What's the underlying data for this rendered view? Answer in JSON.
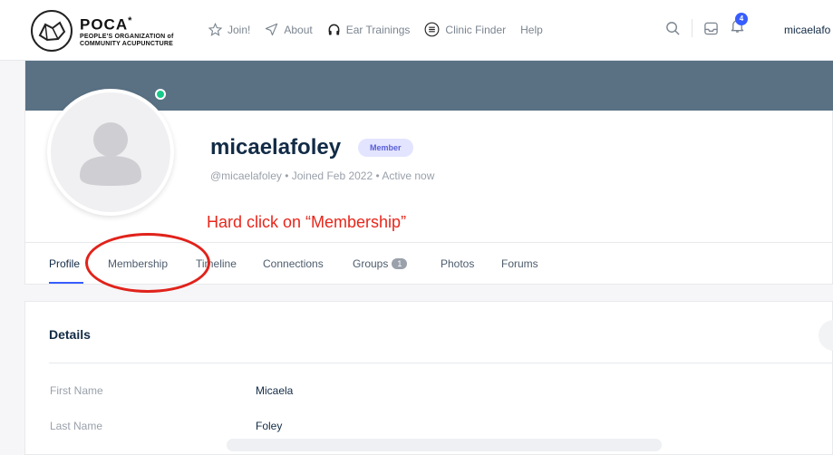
{
  "header": {
    "logo_main": "POCA",
    "logo_star": "*",
    "logo_sub1": "PEOPLE'S ORGANIZATION of",
    "logo_sub2": "COMMUNITY ACUPUNCTURE",
    "nav": [
      {
        "label": "Join!",
        "icon": "star-icon"
      },
      {
        "label": "About",
        "icon": "send-icon"
      },
      {
        "label": "Ear Trainings",
        "icon": "headphones-icon"
      },
      {
        "label": "Clinic Finder",
        "icon": "list-icon"
      },
      {
        "label": "Help",
        "icon": ""
      }
    ],
    "notification_count": "4",
    "username": "micaelafo"
  },
  "profile": {
    "name": "micaelafoley",
    "badge": "Member",
    "meta": "@micaelafoley • Joined Feb 2022 • Active now",
    "instruction": "Hard click on “Membership”",
    "tabs": [
      {
        "label": "Profile"
      },
      {
        "label": "Membership"
      },
      {
        "label": "Timeline"
      },
      {
        "label": "Connections"
      },
      {
        "label": "Groups",
        "count": "1"
      },
      {
        "label": "Photos"
      },
      {
        "label": "Forums"
      }
    ]
  },
  "details": {
    "title": "Details",
    "fields": [
      {
        "label": "First Name",
        "value": "Micaela"
      },
      {
        "label": "Last Name",
        "value": "Foley"
      }
    ]
  },
  "colors": {
    "accent": "#385dff",
    "cover": "#5a7184",
    "annotation": "#e0231b",
    "online": "#18c98a"
  }
}
